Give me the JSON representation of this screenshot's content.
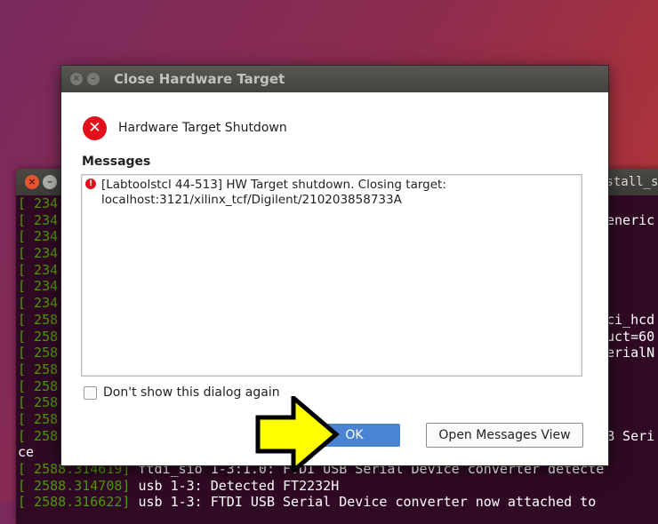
{
  "terminal": {
    "title_fragment": "nstall_se",
    "lines": [
      {
        "ts": "[ 234",
        "right": ""
      },
      {
        "ts": "[ 234",
        "right": "eneric"
      },
      {
        "ts": "[ 234",
        "right": ""
      },
      {
        "ts": "[ 234",
        "right": ""
      },
      {
        "ts": "[ 234",
        "right": ""
      },
      {
        "ts": "[ 234",
        "right": ""
      },
      {
        "ts": "[ 234",
        "right": ""
      },
      {
        "ts": "[ 258",
        "right": "ci_hcd"
      },
      {
        "ts": "[ 258",
        "right": "uct=60"
      },
      {
        "ts": "[ 258",
        "right": "erialN"
      },
      {
        "ts": "[ 258",
        "right": ""
      },
      {
        "ts": "[ 258",
        "right": ""
      },
      {
        "ts": "[ 258",
        "right": ""
      },
      {
        "ts": "[ 258",
        "right": ""
      },
      {
        "ts": "[ 258",
        "right": "B Seri"
      }
    ],
    "wrap_line": "ce",
    "full_lines": [
      {
        "ts": "[ 2588.314619]",
        "text": " ftdi_sio 1-3:1.0: FTDI USB Serial Device converter detecte"
      },
      {
        "ts": "[ 2588.314708]",
        "text": " usb 1-3: Detected FT2232H"
      },
      {
        "ts": "[ 2588.316622]",
        "text": " usb 1-3: FTDI USB Serial Device converter now attached to"
      }
    ]
  },
  "dialog": {
    "title": "Close Hardware Target",
    "close_glyph": "×",
    "min_glyph": "–",
    "header_icon": "error-icon",
    "header_text": "Hardware Target Shutdown",
    "messages_label": "Messages",
    "message_lines": [
      "[Labtoolstcl 44-513] HW Target shutdown. Closing target:",
      "localhost:3121/xilinx_tcf/Digilent/210203858733A"
    ],
    "checkbox_label": "Don't show this dialog again",
    "checkbox_checked": false,
    "ok_label": "OK",
    "open_messages_label": "Open Messages View"
  },
  "colors": {
    "error_red": "#e3101b",
    "ok_blue": "#4b83d3",
    "arrow_yellow": "#ffff00",
    "terminal_bg": "#300a24",
    "terminal_green": "#4e9a06"
  }
}
